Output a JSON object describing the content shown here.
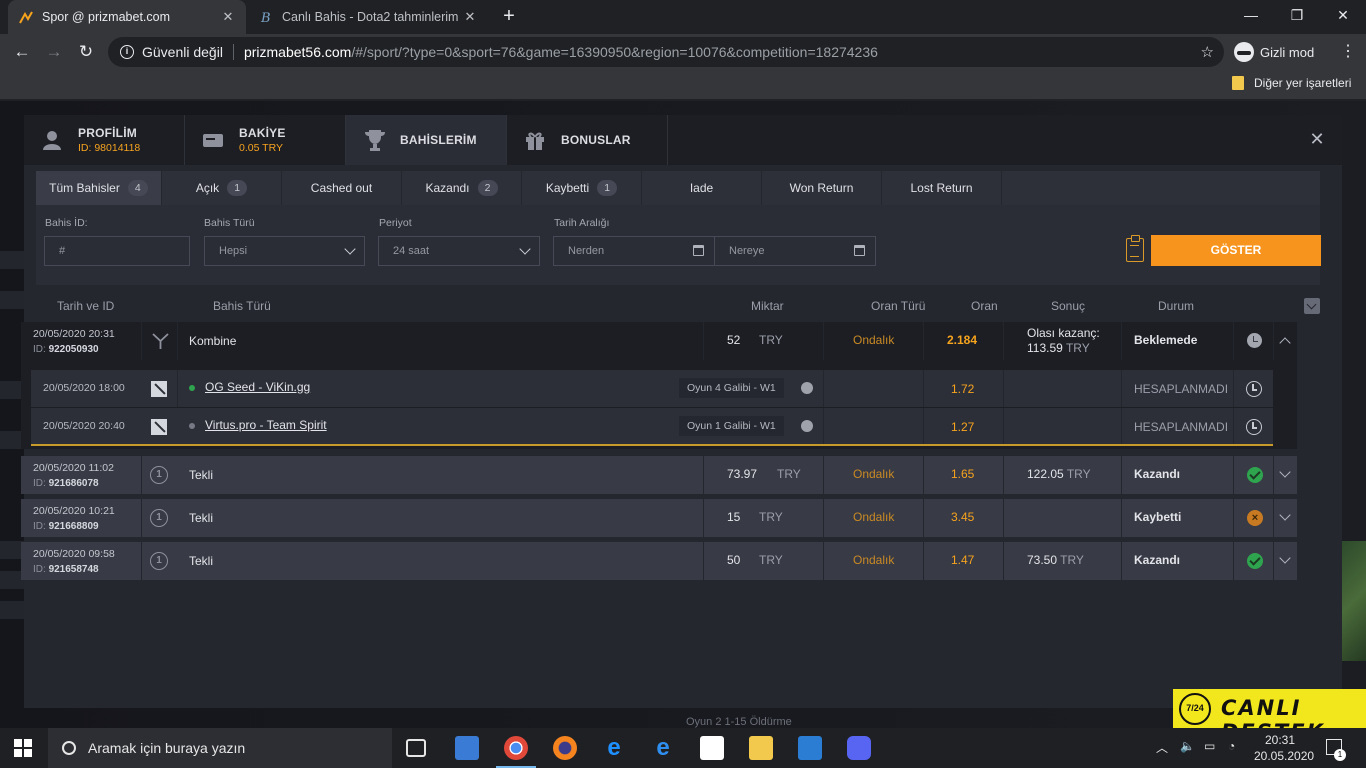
{
  "browser": {
    "tabs": [
      {
        "title": "Spor @ prizmabet.com",
        "active": true
      },
      {
        "title": "Canlı Bahis - Dota2 tahminlerim -",
        "active": false
      }
    ],
    "security_label": "Güvenli değil",
    "url_host": "prizmabet56.com",
    "url_path": "/#/sport/?type=0&sport=76&game=16390950&region=10076&competition=18274236",
    "incognito_label": "Gizli mod",
    "bookmark_folder": "Diğer yer işaretleri"
  },
  "modal": {
    "tabs": [
      {
        "label": "PROFİLİM",
        "sub": "ID: 98014118",
        "icon": "user-icon"
      },
      {
        "label": "BAKİYE",
        "sub": "0.05 TRY",
        "icon": "wallet-icon"
      },
      {
        "label": "BAHİSLERİM",
        "sub": "",
        "icon": "trophy-icon",
        "active": true
      },
      {
        "label": "BONUSLAR",
        "sub": "",
        "icon": "gift-icon"
      }
    ],
    "filter_tabs": [
      {
        "label": "Tüm Bahisler",
        "count": "4",
        "active": true
      },
      {
        "label": "Açık",
        "count": "1"
      },
      {
        "label": "Cashed out",
        "count": ""
      },
      {
        "label": "Kazandı",
        "count": "2"
      },
      {
        "label": "Kaybetti",
        "count": "1"
      },
      {
        "label": "Iade",
        "count": ""
      },
      {
        "label": "Won Return",
        "count": ""
      },
      {
        "label": "Lost Return",
        "count": ""
      }
    ],
    "filters": {
      "bet_id_label": "Bahis İD:",
      "bet_id_placeholder": "#",
      "bet_type_label": "Bahis Türü",
      "bet_type_value": "Hepsi",
      "period_label": "Periyot",
      "period_value": "24 saat",
      "date_range_label": "Tarih Aralığı",
      "date_from": "Nerden",
      "date_to": "Nereye",
      "show_button": "GÖSTER"
    },
    "columns": {
      "date_id": "Tarih ve ID",
      "bet_type": "Bahis Türü",
      "amount": "Miktar",
      "odds_type": "Oran Türü",
      "odds": "Oran",
      "result": "Sonuç",
      "status": "Durum"
    },
    "bets": [
      {
        "date": "20/05/2020 20:31",
        "id": "922050930",
        "type": "Kombine",
        "amount": "52",
        "currency": "TRY",
        "odds_type": "Ondalık",
        "odds": "2.184",
        "result_label": "Olası kazanç:",
        "result_value": "113.59",
        "result_currency": "TRY",
        "status": "Beklemede",
        "status_icon": "pending-clock-icon",
        "expanded": true
      },
      {
        "date": "20/05/2020 11:02",
        "id": "921686078",
        "type": "Tekli",
        "amount": "73.97",
        "currency": "TRY",
        "odds_type": "Ondalık",
        "odds": "1.65",
        "result_value": "122.05",
        "result_currency": "TRY",
        "status": "Kazandı",
        "status_icon": "won-check-icon"
      },
      {
        "date": "20/05/2020 10:21",
        "id": "921668809",
        "type": "Tekli",
        "amount": "15",
        "currency": "TRY",
        "odds_type": "Ondalık",
        "odds": "3.45",
        "result_value": "",
        "result_currency": "",
        "status": "Kaybetti",
        "status_icon": "lost-x-icon"
      },
      {
        "date": "20/05/2020 09:58",
        "id": "921658748",
        "type": "Tekli",
        "amount": "50",
        "currency": "TRY",
        "odds_type": "Ondalık",
        "odds": "1.47",
        "result_value": "73.50",
        "result_currency": "TRY",
        "status": "Kazandı",
        "status_icon": "won-check-icon"
      }
    ],
    "selections": [
      {
        "date": "20/05/2020 18:00",
        "match": "OG Seed - ViKin.gg",
        "market": "Oyun 4 Galibi - W1",
        "odds": "1.72",
        "status": "HESAPLANMADI",
        "dot_color": "#2fa44f"
      },
      {
        "date": "20/05/2020 20:40",
        "match": "Virtus.pro - Team Spirit",
        "market": "Oyun 1 Galibi - W1",
        "odds": "1.27",
        "status": "HESAPLANMADI",
        "dot_color": "#777985"
      }
    ]
  },
  "support_badge": {
    "hours": "7/24",
    "text": "CANLI DESTEK"
  },
  "background_text": "Oyun 2 1-15 Öldürme",
  "taskbar": {
    "search_placeholder": "Aramak için buraya yazın",
    "time": "20:31",
    "date": "20.05.2020",
    "notification_count": "1"
  },
  "colors": {
    "accent": "#f7941d",
    "won": "#2fa44f",
    "lost": "#c77a22",
    "odds": "#f6a31e"
  }
}
